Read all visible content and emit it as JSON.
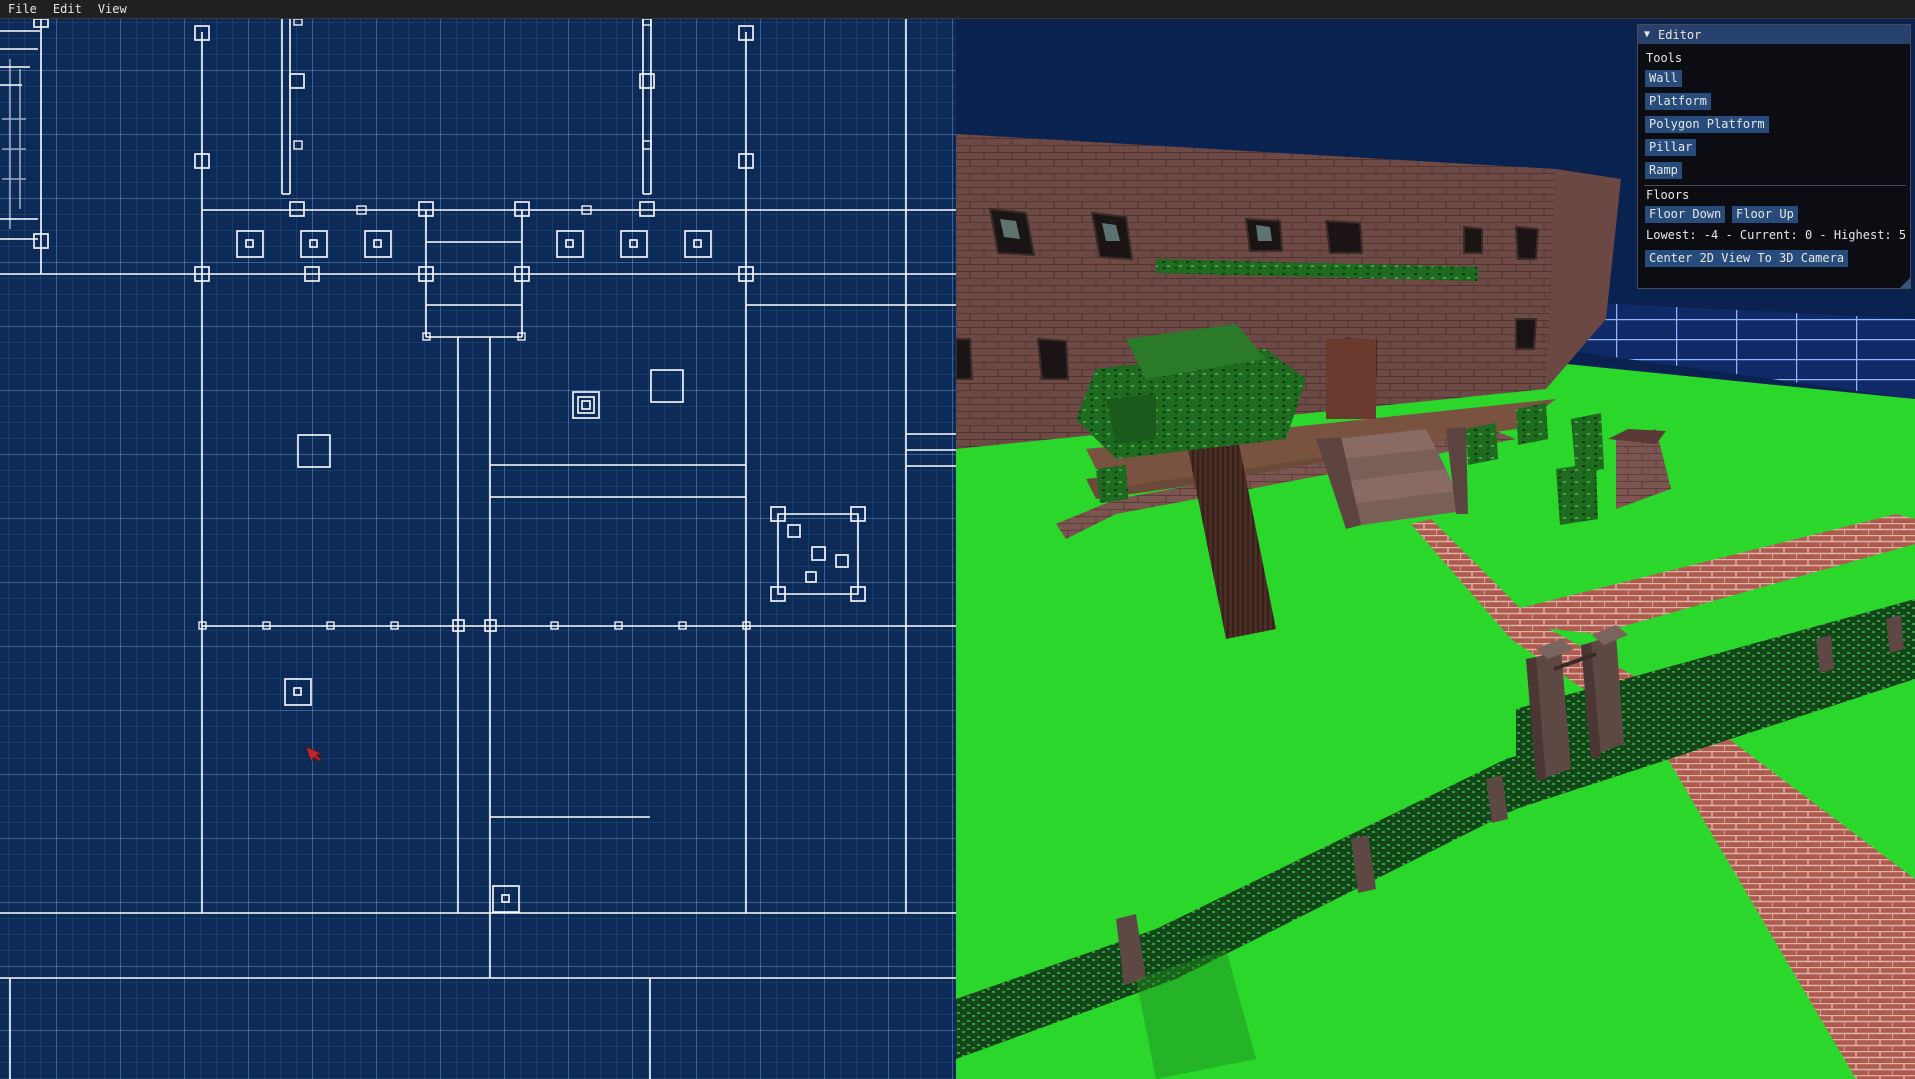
{
  "menu": {
    "file": "File",
    "edit": "Edit",
    "view": "View"
  },
  "editor": {
    "title": "Editor",
    "tools_label": "Tools",
    "tools": {
      "wall": "Wall",
      "platform": "Platform",
      "polygon_platform": "Polygon Platform",
      "pillar": "Pillar",
      "ramp": "Ramp"
    },
    "floors_label": "Floors",
    "floor_down": "Floor Down",
    "floor_up": "Floor Up",
    "floor_info": "Lowest: -4 - Current: 0 - Highest: 5",
    "center_button": "Center 2D View To 3D Camera"
  },
  "colors": {
    "plan_background": "#0c2a57",
    "plan_lines": "#ffffff",
    "cursor": "#c0262a",
    "sky": "#0a2250",
    "grass": "#2bd72b",
    "brick": "#8a5a55",
    "panel_button": "#274c7c",
    "panel_title": "#26416c"
  },
  "icons": {
    "cursor": "mouse-cursor-icon",
    "collapse": "collapse-triangle-icon"
  }
}
